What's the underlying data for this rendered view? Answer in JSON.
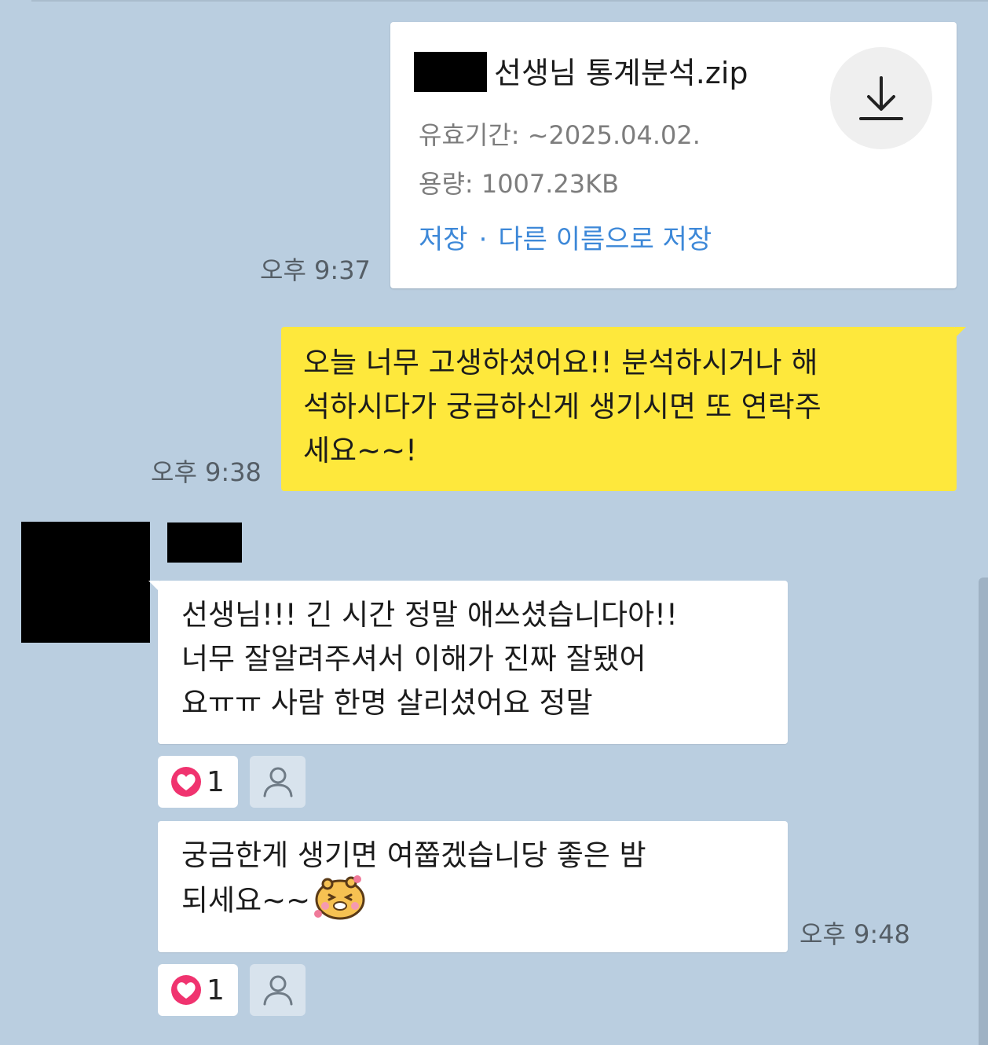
{
  "file_message": {
    "filename_suffix": "선생님 통계분석.zip",
    "expiry": "유효기간: ~2025.04.02.",
    "size": "용량: 1007.23KB",
    "save_label": "저장",
    "separator": "·",
    "save_as_label": "다른 이름으로 저장",
    "time": "오후 9:37"
  },
  "my_message": {
    "lines": [
      "오늘 너무 고생하셨어요!! 분석하시거나 해",
      "석하시다가 궁금하신게 생기시면 또 연락주",
      "세요~~!"
    ],
    "time": "오후 9:38"
  },
  "their_messages": [
    {
      "lines": [
        "선생님!!! 긴 시간 정말 애쓰셨습니다아!!",
        "너무 잘알려주셔서 이해가 진짜 잘됐어",
        "요ㅠㅠ 사람 한명 살리셨어요 정말"
      ],
      "reaction_count": "1"
    },
    {
      "lines": [
        "궁금한게 생기면 여쭙겠습니당 좋은 밤",
        "되세요~~"
      ],
      "reaction_count": "1",
      "time": "오후 9:48"
    }
  ],
  "colors": {
    "background": "#bacee0",
    "my_bubble": "#fee83c",
    "link": "#3d88d8",
    "heart": "#f0336f"
  },
  "icons": [
    "download-icon",
    "heart-icon",
    "person-icon",
    "emoji-sticker"
  ]
}
